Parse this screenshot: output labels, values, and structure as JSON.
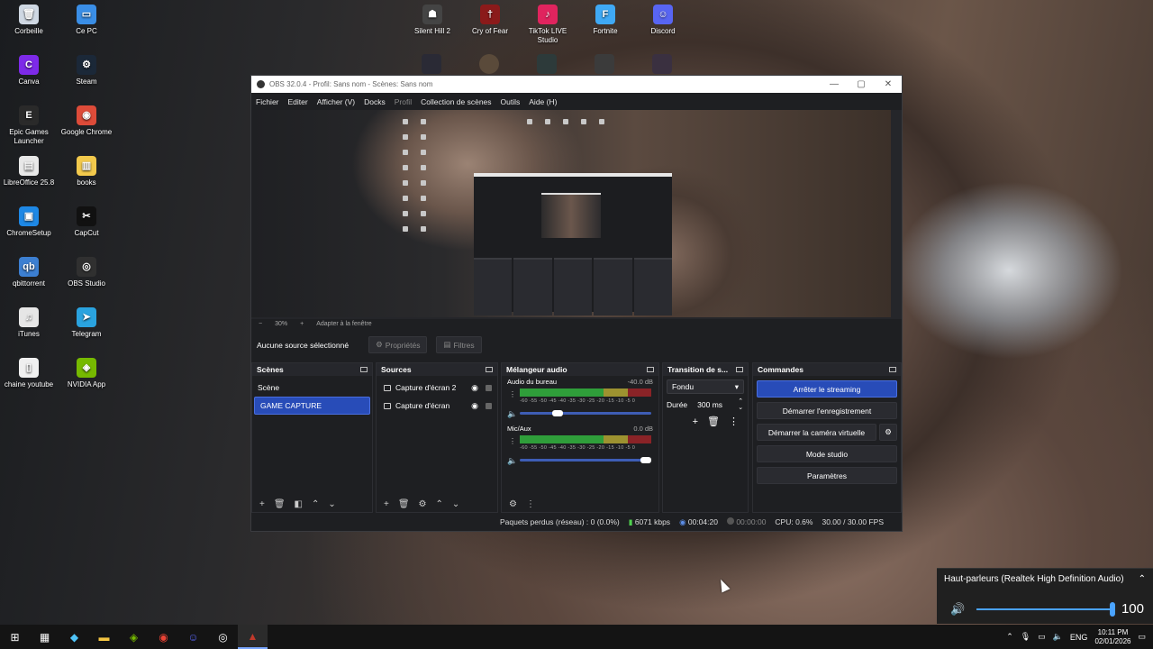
{
  "desktop": {
    "left_icons": [
      {
        "label": "Corbeille",
        "icon": "recycle-bin-icon",
        "color": "#cfd8e3",
        "glyph": "🗑"
      },
      {
        "label": "Ce PC",
        "icon": "computer-icon",
        "color": "#3a8ee6",
        "glyph": "▭"
      },
      {
        "label": "Canva",
        "icon": "canva-icon",
        "color": "#7d2ae8",
        "glyph": "C"
      },
      {
        "label": "Steam",
        "icon": "steam-icon",
        "color": "#1b2838",
        "glyph": "⚙"
      },
      {
        "label": "Epic Games Launcher",
        "icon": "epic-games-icon",
        "color": "#2a2a2a",
        "glyph": "E"
      },
      {
        "label": "Google Chrome",
        "icon": "chrome-icon",
        "color": "#dd4b39",
        "glyph": "◉"
      },
      {
        "label": "LibreOffice 25.8",
        "icon": "libreoffice-icon",
        "color": "#e8e8e8",
        "glyph": "▤"
      },
      {
        "label": "books",
        "icon": "books-icon",
        "color": "#f2c94c",
        "glyph": "▥"
      },
      {
        "label": "ChromeSetup",
        "icon": "installer-icon",
        "color": "#1e88e5",
        "glyph": "▣"
      },
      {
        "label": "CapCut",
        "icon": "capcut-icon",
        "color": "#111111",
        "glyph": "✂"
      },
      {
        "label": "qbittorrent",
        "icon": "qbittorrent-icon",
        "color": "#3c7fd1",
        "glyph": "qb"
      },
      {
        "label": "OBS Studio",
        "icon": "obs-icon",
        "color": "#303030",
        "glyph": "◎"
      },
      {
        "label": "iTunes",
        "icon": "itunes-icon",
        "color": "#e6e6e6",
        "glyph": "♫"
      },
      {
        "label": "Telegram",
        "icon": "telegram-icon",
        "color": "#2aa3df",
        "glyph": "➤"
      },
      {
        "label": "chaine youtube",
        "icon": "file-icon",
        "color": "#f0f0f0",
        "glyph": "▯"
      },
      {
        "label": "NVIDIA App",
        "icon": "nvidia-icon",
        "color": "#76b900",
        "glyph": "◈"
      }
    ],
    "top_icons": [
      {
        "label": "Silent Hill 2",
        "icon": "silent-hill-icon",
        "color": "#444444",
        "glyph": "☗"
      },
      {
        "label": "Cry of Fear",
        "icon": "cry-of-fear-icon",
        "color": "#8b1a1a",
        "glyph": "†"
      },
      {
        "label": "TikTok LIVE Studio",
        "icon": "tiktok-icon",
        "color": "#e0245e",
        "glyph": "♪"
      },
      {
        "label": "Fortnite",
        "icon": "fortnite-icon",
        "color": "#3fa9f5",
        "glyph": "F"
      },
      {
        "label": "Discord",
        "icon": "discord-icon",
        "color": "#5865f2",
        "glyph": "☺"
      }
    ]
  },
  "obs": {
    "title": "OBS 32.0.4 - Profil: Sans nom - Scènes: Sans nom",
    "menu": [
      "Fichier",
      "Editer",
      "Afficher (V)",
      "Docks",
      "Profil",
      "Collection de scènes",
      "Outils",
      "Aide (H)"
    ],
    "zoom": "30%",
    "fit": "Adapter à la fenêtre",
    "no_source": "Aucune source sélectionné",
    "properties": "Propriétés",
    "filters": "Filtres",
    "scenes": {
      "title": "Scènes",
      "items": [
        "Scène",
        "GAME CAPTURE"
      ]
    },
    "sources": {
      "title": "Sources",
      "items": [
        "Capture d'écran 2",
        "Capture d'écran"
      ]
    },
    "mixer": {
      "title": "Mélangeur audio",
      "scale": "-60 -55 -50 -45 -40 -35 -30 -25 -20 -15 -10 -5 0",
      "channels": [
        {
          "name": "Audio du bureau",
          "db": "-40.0 dB",
          "level": 0.2
        },
        {
          "name": "Mic/Aux",
          "db": "0.0 dB",
          "level": 1.0
        }
      ]
    },
    "transition": {
      "title": "Transition de s...",
      "type": "Fondu",
      "duration_label": "Durée",
      "duration": "300 ms"
    },
    "commands": {
      "title": "Commandes",
      "stop_stream": "Arrêter le streaming",
      "start_record": "Démarrer l'enregistrement",
      "start_vcam": "Démarrer la caméra virtuelle",
      "studio_mode": "Mode studio",
      "settings": "Paramètres"
    },
    "status": {
      "dropped": "Paquets perdus (réseau) : 0 (0.0%)",
      "kbps": "6071 kbps",
      "stream_time": "00:04:20",
      "rec_time": "00:00:00",
      "cpu": "CPU: 0.6%",
      "fps": "30.00 / 30.00 FPS"
    }
  },
  "volume_flyout": {
    "device": "Haut-parleurs (Realtek High Definition Audio)",
    "value": "100"
  },
  "taskbar": {
    "lang": "ENG",
    "time": "10:11 PM",
    "date": "02/01/2026"
  }
}
